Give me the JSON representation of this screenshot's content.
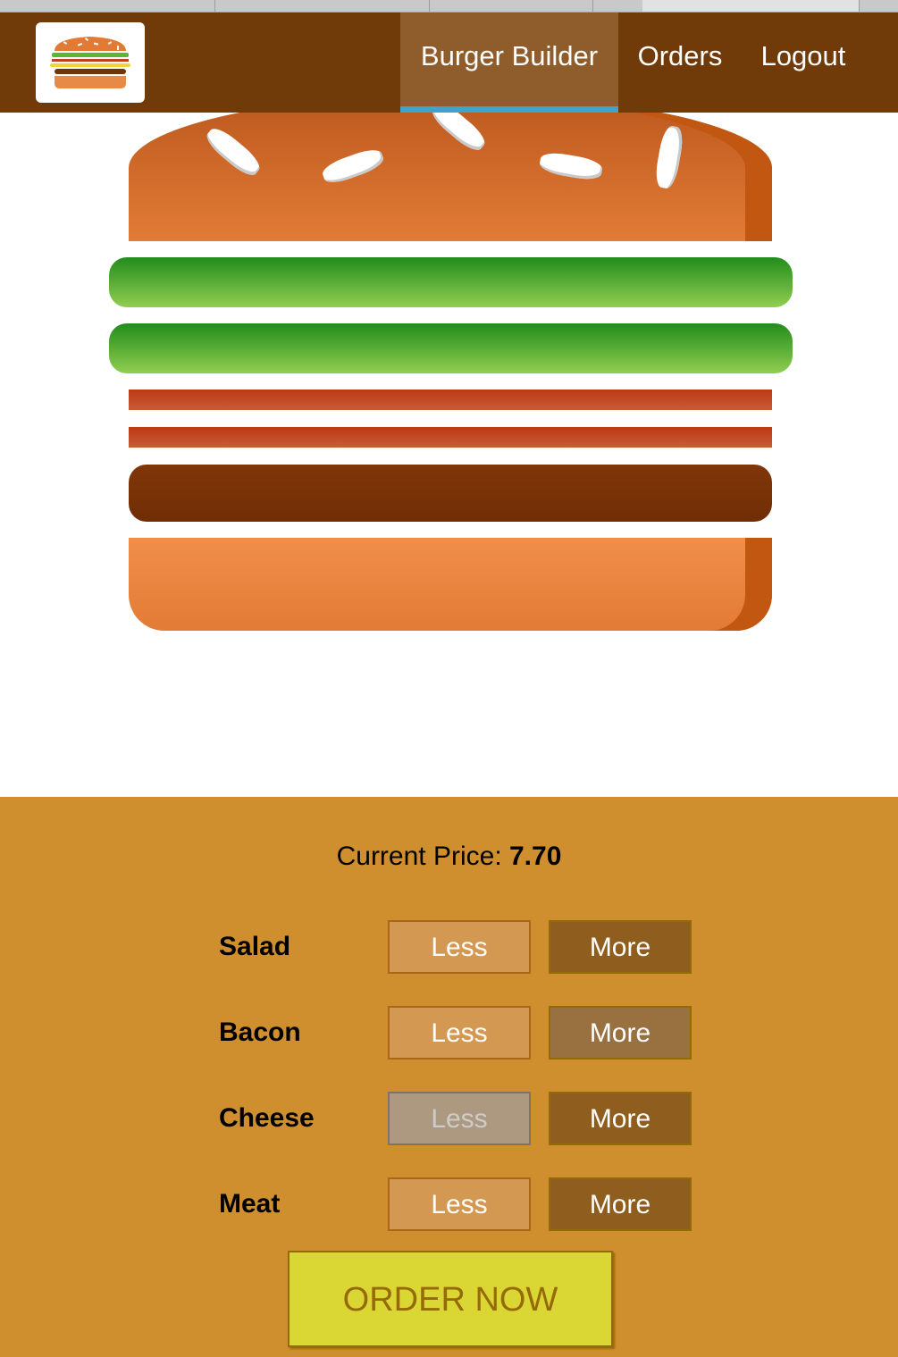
{
  "toolbar": {
    "logo_alt": "burger-logo-icon",
    "nav": [
      {
        "label": "Burger Builder",
        "active": true
      },
      {
        "label": "Orders",
        "active": false
      },
      {
        "label": "Logout",
        "active": false
      }
    ]
  },
  "burger": {
    "ingredients": [
      "salad",
      "salad",
      "bacon",
      "bacon",
      "meat"
    ],
    "counts": {
      "salad": 2,
      "bacon": 2,
      "cheese": 0,
      "meat": 1
    }
  },
  "build_controls": {
    "price_label": "Current Price:",
    "price_value": "7.70",
    "controls": [
      {
        "label": "Salad",
        "less": "Less",
        "more": "More",
        "less_disabled": false
      },
      {
        "label": "Bacon",
        "less": "Less",
        "more": "More",
        "less_disabled": false
      },
      {
        "label": "Cheese",
        "less": "Less",
        "more": "More",
        "less_disabled": true
      },
      {
        "label": "Meat",
        "less": "Less",
        "more": "More",
        "less_disabled": false
      }
    ],
    "order_label": "ORDER NOW"
  },
  "colors": {
    "toolbar": "#703b09",
    "active_tab_underline": "#40a4c8",
    "controls_bg": "#cf8f2e",
    "order_button": "#dad735"
  }
}
